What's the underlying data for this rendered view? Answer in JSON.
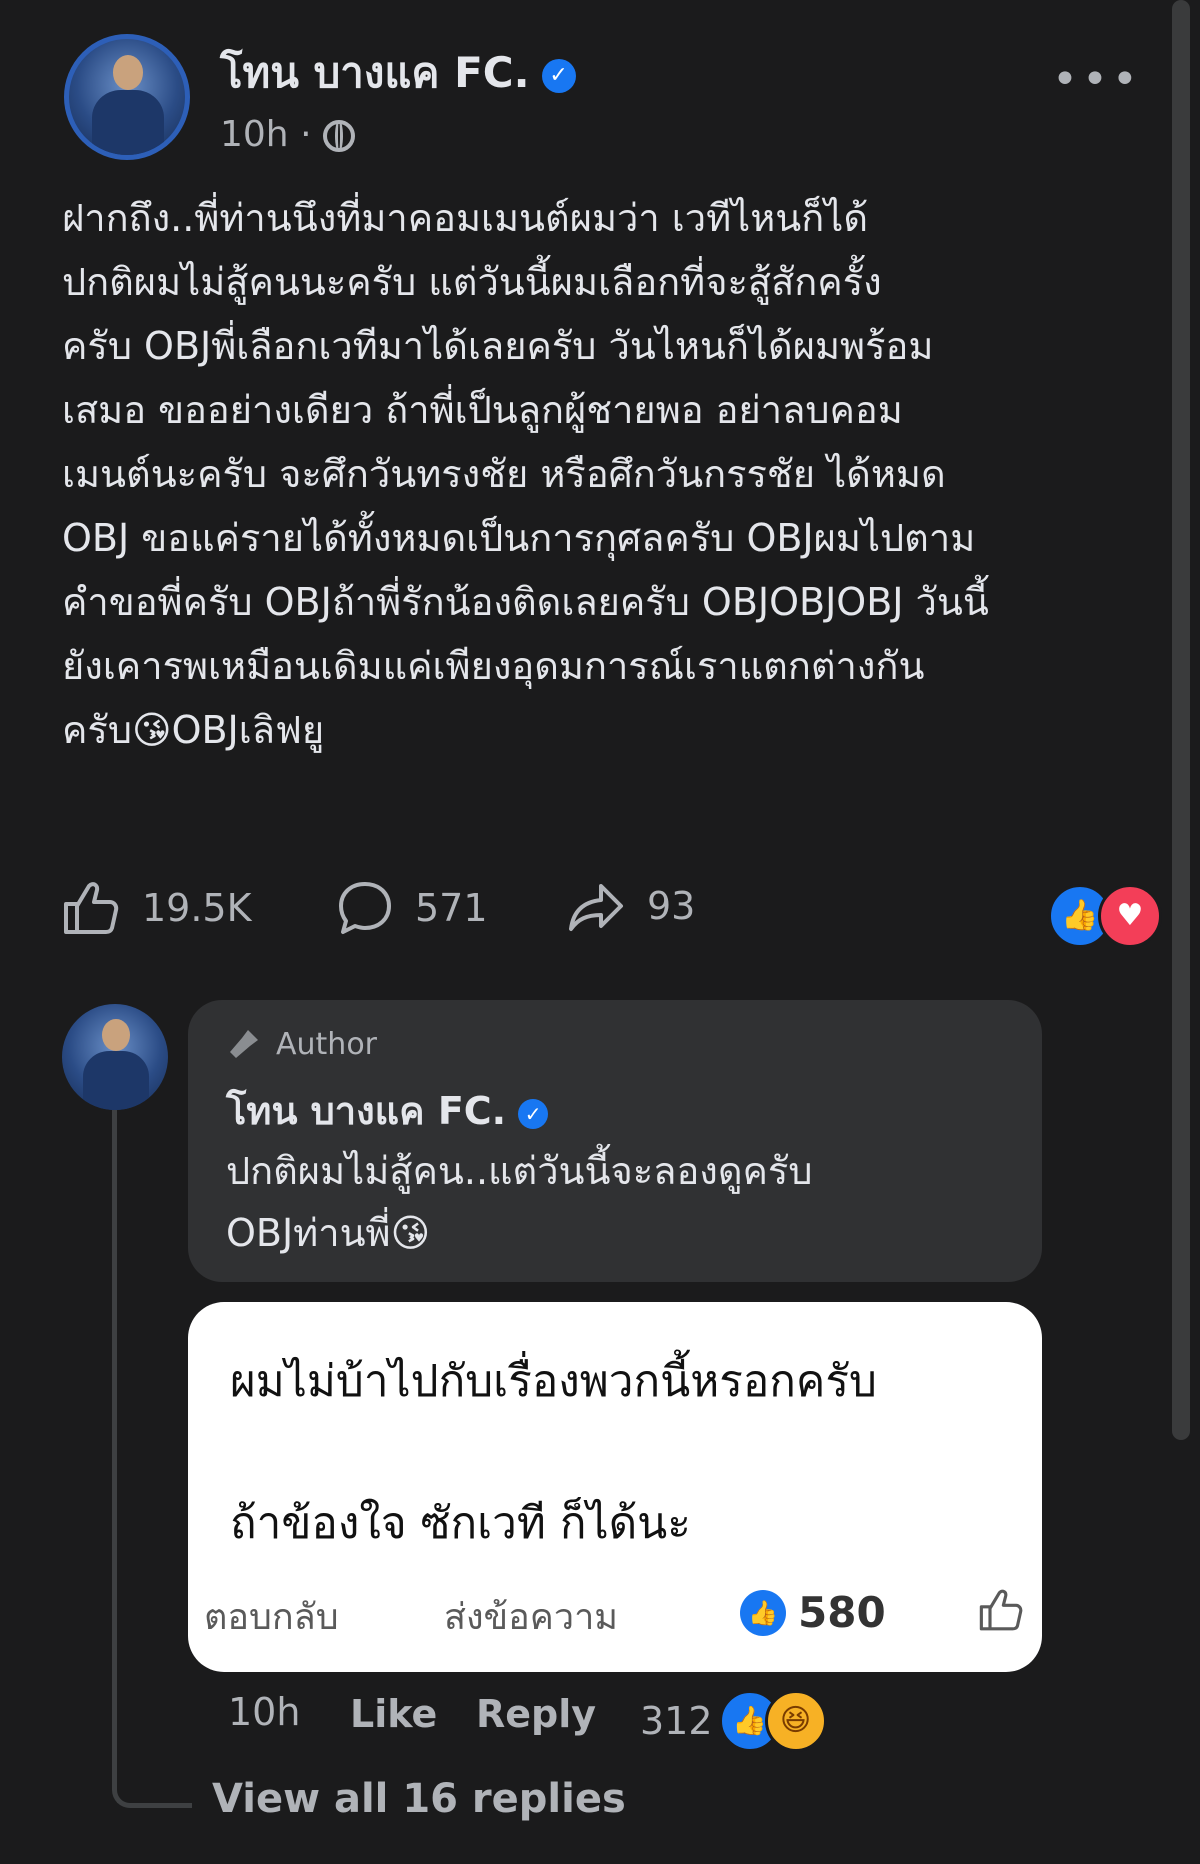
{
  "post": {
    "author": "โทน บางแค FC.",
    "verified_icon": "verified-badge-icon",
    "time": "10h",
    "separator": "·",
    "audience_icon": "globe-icon",
    "more_icon": "more-options-icon",
    "text": "ฝากถึง..พี่ท่านนึงที่มาคอมเมนต์ผมว่า เวทีไหนก็ได้\nปกติผมไม่สู้คนนะครับ แต่วันนี้ผมเลือกที่จะสู้สักครั้ง\nครับ OBJพี่เลือกเวทีมาได้เลยครับ วันไหนก็ได้ผมพร้อม\nเสมอ ขออย่างเดียว ถ้าพี่เป็นลูกผู้ชายพอ อย่าลบคอม\nเมนต์นะครับ จะศึกวันทรงชัย หรือศึกวันกรรชัย ได้หมด\nOBJ ขอแค่รายได้ทั้งหมดเป็นการกุศลครับ OBJผมไปตาม\nคำขอพี่ครับ OBJถ้าพี่รักน้องติดเลยครับ OBJOBJOBJ วันนี้\nยังเคารพเหมือนเดิมแค่เพียงอุดมการณ์เราแตกต่างกัน\nครับ😘OBJเลิฟยู"
  },
  "stats": {
    "likes": "19.5K",
    "comments": "571",
    "shares": "93",
    "like_icon": "thumbs-up-icon",
    "comment_icon": "comment-bubble-icon",
    "share_icon": "share-arrow-icon",
    "reaction_like_glyph": "👍",
    "reaction_love_glyph": "♥"
  },
  "comment": {
    "badge": "Author",
    "badge_icon": "microphone-icon",
    "author": "โทน บางแค FC.",
    "text": "ปกติผมไม่สู้คน..แต่วันนี้จะลองดูครับ\nOBJท่านพี่😘",
    "time": "10h",
    "like_label": "Like",
    "reply_label": "Reply",
    "reaction_count": "312",
    "reaction_like_glyph": "👍",
    "reaction_haha_glyph": "😆"
  },
  "overlay": {
    "line1": "ผมไม่บ้าไปกับเรื่องพวกนี้หรอกครับ",
    "line2": "ถ้าข้องใจ ซักเวที ก็ได้นะ",
    "reply_label": "ตอบกลับ",
    "message_label": "ส่งข้อความ",
    "like_count": "580",
    "like_glyph": "👍"
  },
  "view_replies": "View all 16 replies",
  "colors": {
    "background": "#1b1b1c",
    "bubble": "#303133",
    "accent": "#1877f2",
    "love": "#f33e58",
    "text_primary": "#e4e6eb",
    "text_secondary": "#b0b3b8"
  }
}
